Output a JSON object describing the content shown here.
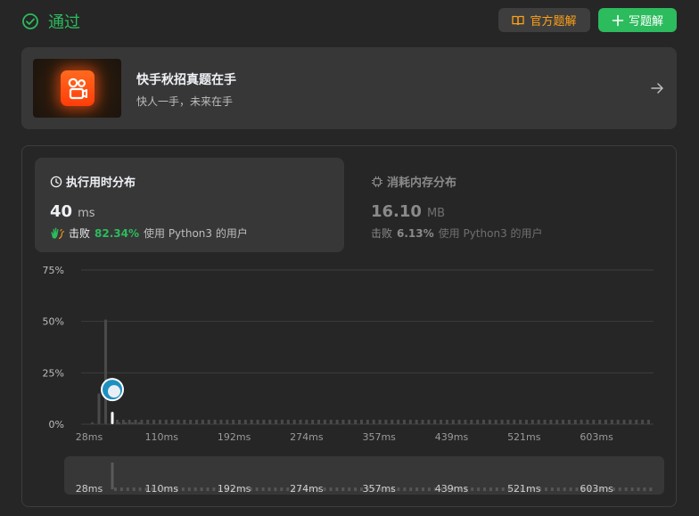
{
  "header": {
    "status": "通过",
    "solution_button": "官方题解",
    "write_button": "写题解"
  },
  "banner": {
    "title": "快手秋招真题在手",
    "subtitle": "快人一手，未来在手"
  },
  "runtime": {
    "title": "执行用时分布",
    "value": "40",
    "unit": "ms",
    "beat_prefix": "击败",
    "beat_percent": "82.34%",
    "beat_suffix": "使用 Python3 的用户"
  },
  "memory": {
    "title": "消耗内存分布",
    "value": "16.10",
    "unit": "MB",
    "beat_prefix": "击败",
    "beat_percent": "6.13%",
    "beat_suffix": "使用 Python3 的用户"
  },
  "colors": {
    "accent_green": "#2cbb5d",
    "accent_orange": "#ffa116",
    "background": "#262626",
    "card": "#373737"
  },
  "chart_data": {
    "type": "bar",
    "ylabels": [
      "75%",
      "50%",
      "25%",
      "0%"
    ],
    "ylim": [
      0,
      75
    ],
    "xticks": [
      "28ms",
      "110ms",
      "192ms",
      "274ms",
      "357ms",
      "439ms",
      "521ms",
      "603ms"
    ],
    "x": [
      28,
      32,
      36,
      40,
      44,
      48,
      52,
      56
    ],
    "values": [
      1,
      15,
      51,
      6,
      1,
      1,
      1,
      1
    ],
    "your_runtime_ms": 40,
    "grid": true,
    "minimap_xticks": [
      "28ms",
      "110ms",
      "192ms",
      "274ms",
      "357ms",
      "439ms",
      "521ms",
      "603ms"
    ]
  }
}
